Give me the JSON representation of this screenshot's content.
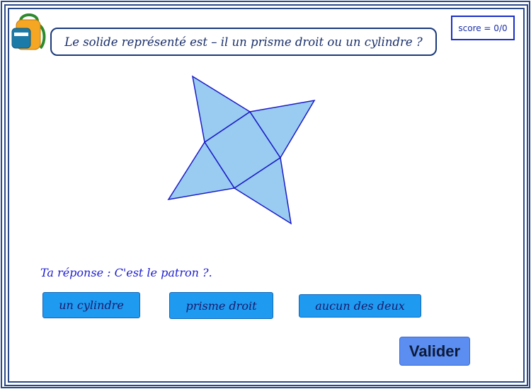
{
  "question": "Le solide représenté est – il un prisme droit ou un cylindre ?",
  "score": "score = 0/0",
  "answer_prompt": "Ta réponse :  C'est le patron ?.",
  "choices": [
    "un cylindre",
    "prisme droit",
    "aucun des deux"
  ],
  "validate_label": "Valider",
  "icons": {
    "app_logo": "backpack-icon"
  },
  "colors": {
    "frame": "#2b4a8a",
    "shape_fill": "#99ccf0",
    "shape_stroke": "#1a1ac8",
    "choice_bg": "#1e9af0",
    "validate_bg": "#5b8ef0",
    "score_border": "#1a2fc8"
  }
}
